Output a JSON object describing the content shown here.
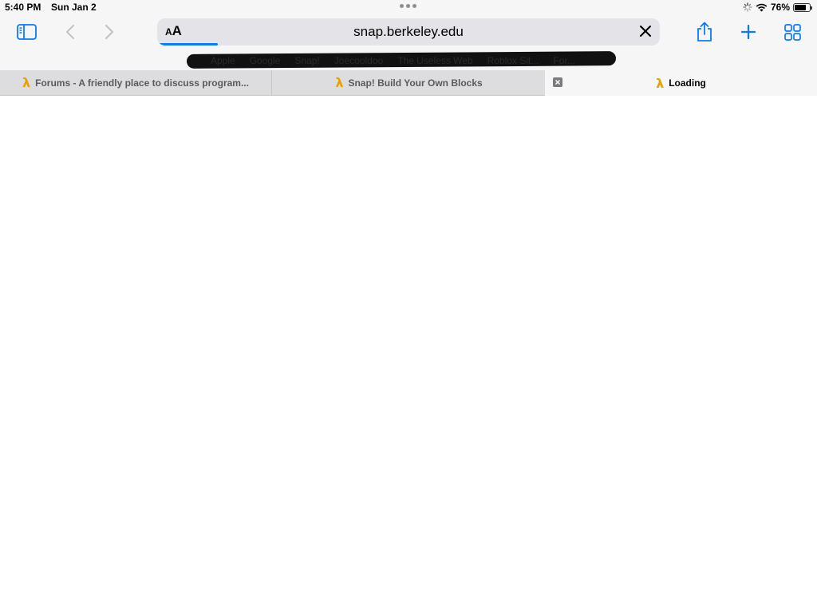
{
  "status_bar": {
    "time": "5:40 PM",
    "date": "Sun Jan 2",
    "battery_percent_text": "76%",
    "battery_level": 0.76,
    "icons": [
      "activity-spinner-icon",
      "wifi-icon",
      "battery-icon"
    ]
  },
  "toolbar": {
    "icons": [
      "sidebar-icon",
      "back-icon",
      "forward-icon",
      "share-icon",
      "new-tab-icon",
      "tab-overview-icon"
    ]
  },
  "address_bar": {
    "reader_label_small": "A",
    "reader_label_large": "A",
    "url": "snap.berkeley.edu",
    "load_progress": 0.12
  },
  "favorites": {
    "items": [
      "Apple",
      "Google",
      "Snap!",
      "Joecooldoo",
      "The Useless Web",
      "Roblox Sit...",
      "For..."
    ],
    "redacted": true
  },
  "tabs": [
    {
      "label": "Forums - A friendly place to discuss program...",
      "active": false,
      "icon": "lambda-icon"
    },
    {
      "label": "Snap! Build Your Own Blocks",
      "active": false,
      "icon": "lambda-icon"
    },
    {
      "label": "Loading",
      "active": true,
      "icon": "lambda-icon"
    }
  ],
  "colors": {
    "accent": "#0a7aff",
    "snap_lambda": "#e6a100",
    "toolbar_bg": "#f6f6f6",
    "tab_bar_bg": "#dddde0"
  }
}
